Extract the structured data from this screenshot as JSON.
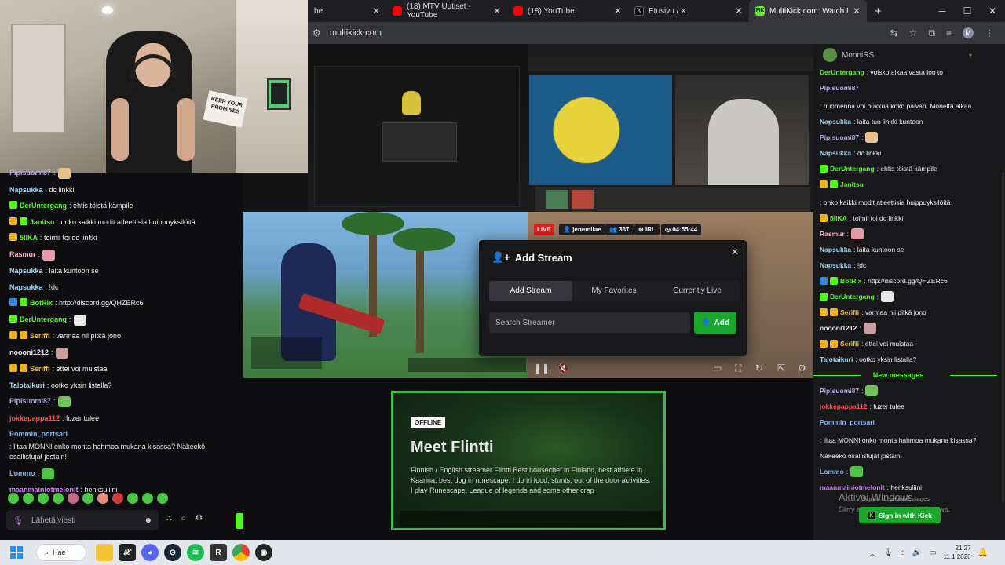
{
  "browser": {
    "tabs": [
      {
        "label": "be",
        "favicon_color": "#ff0000"
      },
      {
        "label": "(18) MTV Uutiset - YouTube",
        "favicon_color": "#ff0000"
      },
      {
        "label": "(18) YouTube",
        "favicon_color": "#ff0000"
      },
      {
        "label": "Etusivu / X",
        "favicon_color": "#000000"
      },
      {
        "label": "MultiKick.com: Watch Multipl",
        "favicon_color": "#53fc18",
        "active": true
      }
    ],
    "url": "multikick.com",
    "profile_initial": "M"
  },
  "webcam": {
    "sign_text": "KEEP YOUR PROMISES"
  },
  "left_chat": {
    "messages": [
      {
        "user": "Pipisuomi87",
        "color": "#b9a5e8",
        "text": ":",
        "emote": "#e6c28a"
      },
      {
        "user": "Napsukka",
        "color": "#9bd4f5",
        "text": ": dc linkki"
      },
      {
        "user": "DerUntergang",
        "color": "#53fc18",
        "text": ": ehtis töistä kämpile",
        "badges": [
          "#53fc18"
        ]
      },
      {
        "user": "Janitsu",
        "color": "#53fc18",
        "text": ": onko kaikki modit atleettisia huippuyksilöitä",
        "badges": [
          "#f0b020",
          "#53fc18"
        ]
      },
      {
        "user": "5IIKA",
        "color": "#53fc18",
        "text": ": toimii toi dc linkki",
        "badges": [
          "#f0b020"
        ]
      },
      {
        "user": "Rasmur",
        "color": "#f7b0c0",
        "text": ":",
        "emote": "#e79ba6"
      },
      {
        "user": "Napsukka",
        "color": "#9bd4f5",
        "text": ": laita kuntoon se"
      },
      {
        "user": "Napsukka",
        "color": "#9bd4f5",
        "text": ": !dc"
      },
      {
        "user": "BotRix",
        "color": "#53fc18",
        "text": ": http://discord.gg/QHZERc6",
        "badges": [
          "#2e86de",
          "#53fc18"
        ]
      },
      {
        "user": "DerUntergang",
        "color": "#53fc18",
        "text": ":",
        "badges": [
          "#53fc18"
        ],
        "emote": "#e8e8e8"
      },
      {
        "user": "Seriffi",
        "color": "#f0c040",
        "text": ": varmaa nii pitkä jono",
        "badges": [
          "#f0b020",
          "#f0b020"
        ]
      },
      {
        "user": "noooni1212",
        "color": "#efeff1",
        "text": ":",
        "emote": "#c9a0a0"
      },
      {
        "user": "Seriffi",
        "color": "#f0c040",
        "text": ": ettei voi muistaa",
        "badges": [
          "#f0b020",
          "#f0b020"
        ]
      },
      {
        "user": "Talotaikuri",
        "color": "#9bd4f5",
        "text": ": ootko yksin listalla?"
      },
      {
        "user": "Pipisuomi87",
        "color": "#b9a5e8",
        "text": ":",
        "emote": "#6fc35a"
      },
      {
        "user": "jokkepappa112",
        "color": "#ff4f4f",
        "text": ": fuzer tulee"
      },
      {
        "user": "Pommin_portsari",
        "color": "#7ab6ff",
        "text": ": Iltaa MONNI onko monta hahmoa mukana kisassa? Näkeekö osallistujat jostain!"
      },
      {
        "user": "Lommo",
        "color": "#7ab6ff",
        "text": ":",
        "emote": "#4cc745"
      },
      {
        "user": "maanmainiotmelonit",
        "color": "#d37cf5",
        "text": ": henksuliini"
      }
    ],
    "input_placeholder": "Lähetä viesti"
  },
  "modal": {
    "title": "Add Stream",
    "tabs": [
      "Add Stream",
      "My Favorites",
      "Currently Live"
    ],
    "search_placeholder": "Search Streamer",
    "add_label": "Add"
  },
  "stream_overlay": {
    "live_label": "LIVE",
    "streamer": "jenemilae",
    "viewers": "337",
    "tag": "IRL",
    "uptime": "04:55:44"
  },
  "offline_card": {
    "badge": "OFFLINE",
    "title": "Meet Flintti",
    "description": "Finnish / English streamer Flintti Best housechef in Finland, best athlete in Kaarina, best dog in runescape. I do irl food, stunts, out of the door activities. I play Runescape, League of legends and some other crap"
  },
  "right_chat": {
    "header_user": "MonniRS",
    "messages": [
      {
        "user": "DerUntergang",
        "color": "#53fc18",
        "text": ": voisko aikaa vasta loo to"
      },
      {
        "user": "Pipisuomi87",
        "color": "#b9a5e8",
        "text": ": huomenna voi nukkua koko päivän. Monelta alkaa"
      },
      {
        "user": "Napsukka",
        "color": "#9bd4f5",
        "text": ": laita tuo linkki kuntoon"
      },
      {
        "user": "Pipisuomi87",
        "color": "#b9a5e8",
        "text": ":",
        "emote": "#e6c28a"
      },
      {
        "user": "Napsukka",
        "color": "#9bd4f5",
        "text": ": dc linkki"
      },
      {
        "user": "DerUntergang",
        "color": "#53fc18",
        "text": ": ehtis töistä kämpile",
        "badges": [
          "#53fc18"
        ]
      },
      {
        "user": "Janitsu",
        "color": "#53fc18",
        "text": ": onko kaikki modit atleettisia huippuyksilöitä",
        "badges": [
          "#f0b020",
          "#53fc18"
        ]
      },
      {
        "user": "5IIKA",
        "color": "#53fc18",
        "text": ": toimii toi dc linkki",
        "badges": [
          "#f0b020"
        ]
      },
      {
        "user": "Rasmur",
        "color": "#f7b0c0",
        "text": ":",
        "emote": "#e79ba6"
      },
      {
        "user": "Napsukka",
        "color": "#9bd4f5",
        "text": ": laita kuntoon se"
      },
      {
        "user": "Napsukka",
        "color": "#9bd4f5",
        "text": ": !dc"
      },
      {
        "user": "BotRix",
        "color": "#53fc18",
        "text": ": http://discord.gg/QHZERc6",
        "badges": [
          "#2e86de",
          "#53fc18"
        ]
      },
      {
        "user": "DerUntergang",
        "color": "#53fc18",
        "text": ":",
        "badges": [
          "#53fc18"
        ],
        "emote": "#e8e8e8"
      },
      {
        "user": "Seriffi",
        "color": "#f0c040",
        "text": ": varmaa nii pitkä jono",
        "badges": [
          "#f0b020",
          "#f0b020"
        ]
      },
      {
        "user": "noooni1212",
        "color": "#efeff1",
        "text": ":",
        "emote": "#c9a0a0"
      },
      {
        "user": "Seriffi",
        "color": "#f0c040",
        "text": ": ettei voi muistaa",
        "badges": [
          "#f0b020",
          "#f0b020"
        ]
      },
      {
        "user": "Talotaikuri",
        "color": "#9bd4f5",
        "text": ": ootko yksin listalla?"
      }
    ],
    "new_messages_label": "New messages",
    "new_messages": [
      {
        "user": "Pipisuomi87",
        "color": "#b9a5e8",
        "text": ":",
        "emote": "#6fc35a"
      },
      {
        "user": "jokkepappa112",
        "color": "#ff4f4f",
        "text": ": fuzer tulee"
      },
      {
        "user": "Pommin_portsari",
        "color": "#7ab6ff",
        "text": ": Iltaa MONNI onko monta hahmoa mukana kisassa? Näkeekö osallistujat jostain!"
      },
      {
        "user": "Lommo",
        "color": "#7ab6ff",
        "text": ":",
        "emote": "#4cc745"
      },
      {
        "user": "maanmainiotmelonit",
        "color": "#d37cf5",
        "text": ": henksuliini"
      }
    ],
    "signin_hint": "Sign in to send messages",
    "signin_label": "Sign in with Kick"
  },
  "windows": {
    "activate_title": "Aktivoi Windows",
    "activate_sub": "Siirry asetuksiin ja aktivoi Windows.",
    "search_label": "Hae",
    "time": "21.27",
    "date": "11.1.2026"
  },
  "colors": {
    "kick_green": "#53fc18",
    "button_green": "#1aa72e",
    "live_red": "#e91916"
  }
}
